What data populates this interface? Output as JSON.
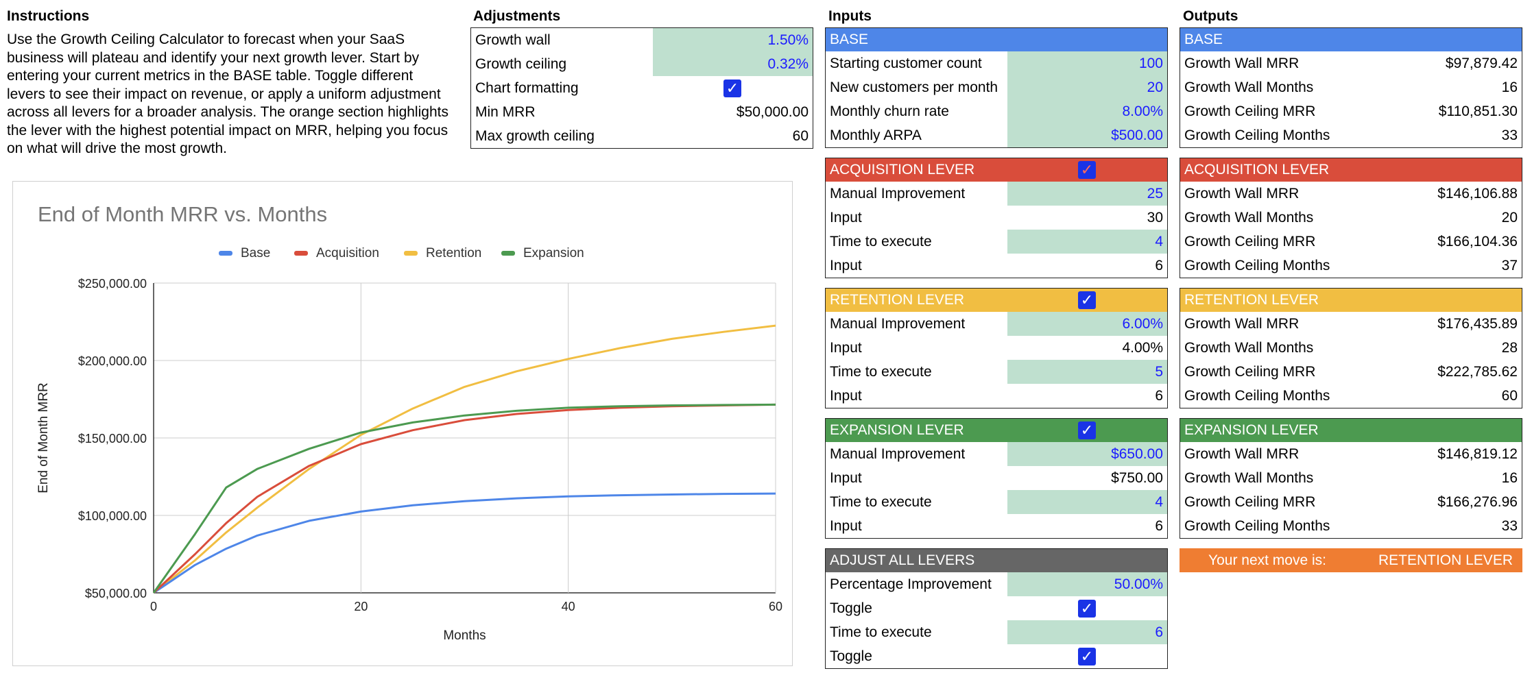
{
  "instructions": {
    "title": "Instructions",
    "text": "Use the Growth Ceiling Calculator to forecast when your SaaS business will plateau and identify your next growth lever. Start by entering your current metrics in the BASE table. Toggle different levers to see their impact on revenue, or apply a uniform adjustment across all levers for a broader analysis. The orange section highlights the lever with the highest potential impact on MRR, helping you focus on what will drive the most growth."
  },
  "adjustments": {
    "title": "Adjustments",
    "rows": [
      {
        "label": "Growth wall",
        "value": "1.50%"
      },
      {
        "label": "Growth ceiling",
        "value": "0.32%"
      },
      {
        "label": "Chart formatting",
        "value": "✓"
      },
      {
        "label": "Min MRR",
        "value": "$50,000.00"
      },
      {
        "label": "Max growth ceiling",
        "value": "60"
      }
    ]
  },
  "inputs": {
    "title": "Inputs",
    "base": {
      "header": "BASE",
      "rows": [
        {
          "label": "Starting customer count",
          "value": "100"
        },
        {
          "label": "New customers per month",
          "value": "20"
        },
        {
          "label": "Monthly churn rate",
          "value": "8.00%"
        },
        {
          "label": "Monthly ARPA",
          "value": "$500.00"
        }
      ]
    },
    "acquisition": {
      "header": "ACQUISITION LEVER",
      "rows": [
        {
          "label": "Manual Improvement",
          "value": "25"
        },
        {
          "label": "Input",
          "value": "30"
        },
        {
          "label": "Time to execute",
          "value": "4"
        },
        {
          "label": "Input",
          "value": "6"
        }
      ]
    },
    "retention": {
      "header": "RETENTION LEVER",
      "rows": [
        {
          "label": "Manual Improvement",
          "value": "6.00%"
        },
        {
          "label": "Input",
          "value": "4.00%"
        },
        {
          "label": "Time to execute",
          "value": "5"
        },
        {
          "label": "Input",
          "value": "6"
        }
      ]
    },
    "expansion": {
      "header": "EXPANSION LEVER",
      "rows": [
        {
          "label": "Manual Improvement",
          "value": "$650.00"
        },
        {
          "label": "Input",
          "value": "$750.00"
        },
        {
          "label": "Time to execute",
          "value": "4"
        },
        {
          "label": "Input",
          "value": "6"
        }
      ]
    },
    "adjust_all": {
      "header": "ADJUST ALL LEVERS",
      "rows": [
        {
          "label": "Percentage Improvement",
          "value": "50.00%"
        },
        {
          "label": "Toggle",
          "value": "✓"
        },
        {
          "label": "Time to execute",
          "value": "6"
        },
        {
          "label": "Toggle",
          "value": "✓"
        }
      ]
    },
    "check": "✓"
  },
  "outputs": {
    "title": "Outputs",
    "base": {
      "header": "BASE",
      "rows": [
        {
          "label": "Growth Wall MRR",
          "value": "$97,879.42"
        },
        {
          "label": "Growth Wall Months",
          "value": "16"
        },
        {
          "label": "Growth Ceiling MRR",
          "value": "$110,851.30"
        },
        {
          "label": "Growth Ceiling Months",
          "value": "33"
        }
      ]
    },
    "acquisition": {
      "header": "ACQUISITION LEVER",
      "rows": [
        {
          "label": "Growth Wall MRR",
          "value": "$146,106.88"
        },
        {
          "label": "Growth Wall Months",
          "value": "20"
        },
        {
          "label": "Growth Ceiling MRR",
          "value": "$166,104.36"
        },
        {
          "label": "Growth Ceiling Months",
          "value": "37"
        }
      ]
    },
    "retention": {
      "header": "RETENTION LEVER",
      "rows": [
        {
          "label": "Growth Wall MRR",
          "value": "$176,435.89"
        },
        {
          "label": "Growth Wall Months",
          "value": "28"
        },
        {
          "label": "Growth Ceiling MRR",
          "value": "$222,785.62"
        },
        {
          "label": "Growth Ceiling Months",
          "value": "60"
        }
      ]
    },
    "expansion": {
      "header": "EXPANSION LEVER",
      "rows": [
        {
          "label": "Growth Wall MRR",
          "value": "$146,819.12"
        },
        {
          "label": "Growth Wall Months",
          "value": "16"
        },
        {
          "label": "Growth Ceiling MRR",
          "value": "$166,276.96"
        },
        {
          "label": "Growth Ceiling Months",
          "value": "33"
        }
      ]
    },
    "next_move": {
      "label": "Your next move is:",
      "value": "RETENTION LEVER"
    }
  },
  "colors": {
    "base": "#4e86e8",
    "acquisition": "#d94d3b",
    "retention": "#f1be42",
    "expansion": "#4c9a50",
    "adjust_all": "#666666",
    "next_move": "#ef7d32",
    "input_cell": "#bfe0cf",
    "input_text": "#1b1bff"
  },
  "chart_data": {
    "type": "line",
    "title": "End of Month MRR vs. Months",
    "xlabel": "Months",
    "ylabel": "End of Month MRR",
    "xlim": [
      0,
      60
    ],
    "ylim": [
      50000,
      250000
    ],
    "x_ticks": [
      "0",
      "20",
      "40",
      "60"
    ],
    "y_ticks": [
      "$50,000.00",
      "$100,000.00",
      "$150,000.00",
      "$200,000.00",
      "$250,000.00"
    ],
    "legend_position": "top",
    "grid": true,
    "x": [
      0,
      4,
      7,
      10,
      15,
      20,
      25,
      30,
      35,
      40,
      45,
      50,
      55,
      60
    ],
    "series": [
      {
        "name": "Base",
        "color": "#4e86e8",
        "values": [
          50000,
          68000,
          78500,
          87000,
          96500,
          102500,
          106500,
          109200,
          111000,
          112300,
          113000,
          113500,
          113900,
          114100
        ]
      },
      {
        "name": "Acquisition",
        "color": "#d94d3b",
        "values": [
          50000,
          75000,
          95000,
          112000,
          132000,
          146000,
          155000,
          161500,
          165500,
          168000,
          169500,
          170500,
          171000,
          171500
        ]
      },
      {
        "name": "Retention",
        "color": "#f1be42",
        "values": [
          50000,
          71000,
          89000,
          105000,
          130000,
          152000,
          169000,
          183000,
          193000,
          201000,
          208000,
          214000,
          218500,
          222500
        ]
      },
      {
        "name": "Expansion",
        "color": "#4c9a50",
        "values": [
          50000,
          88000,
          118000,
          130000,
          143000,
          153500,
          160000,
          164500,
          167500,
          169500,
          170500,
          171000,
          171300,
          171500
        ]
      }
    ]
  }
}
